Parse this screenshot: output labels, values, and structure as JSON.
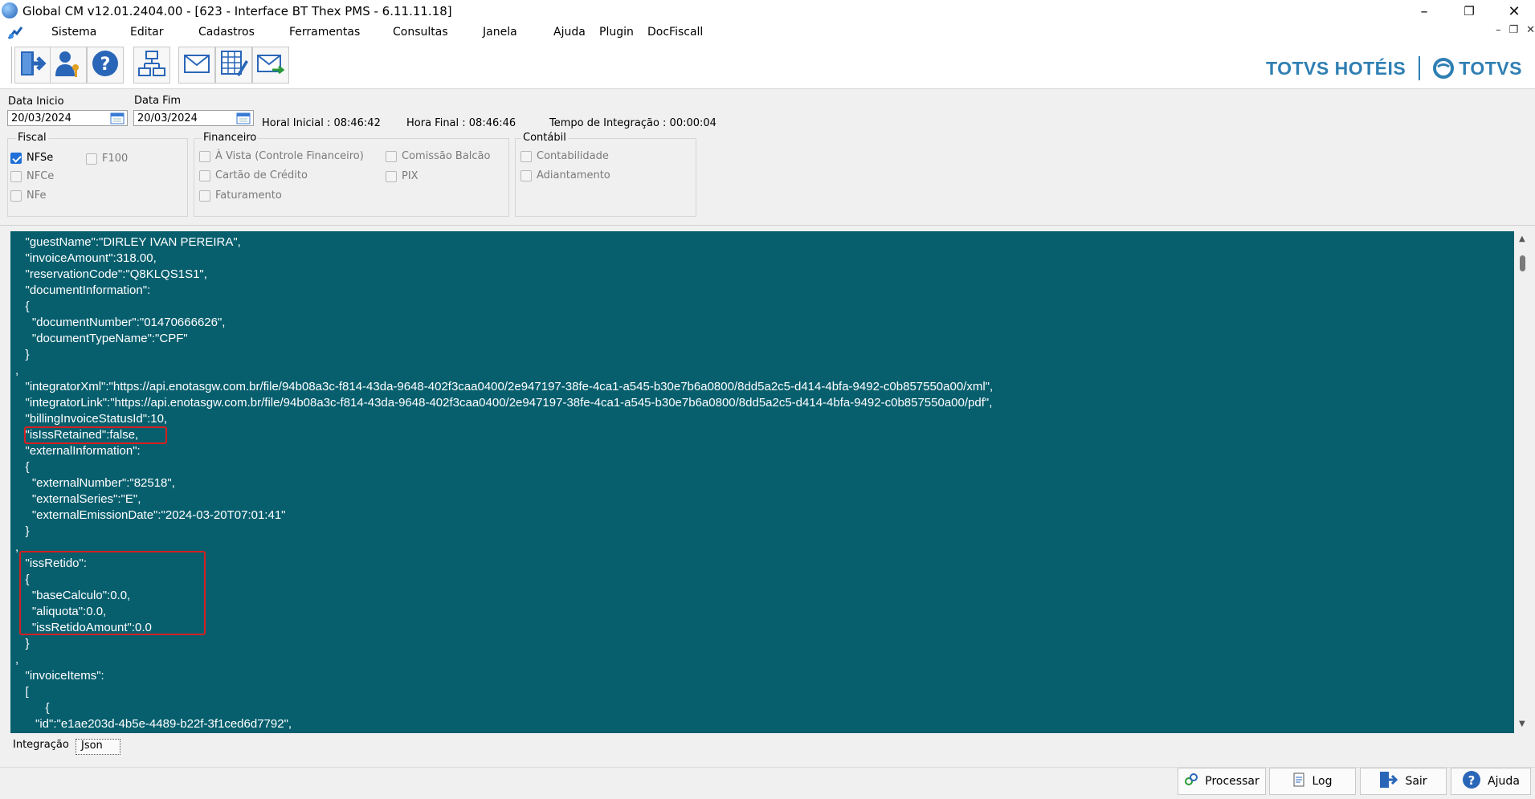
{
  "window": {
    "title": "Global CM v12.01.2404.00 - [623 - Interface BT Thex PMS - 6.11.11.18]"
  },
  "menu": {
    "items": [
      "Sistema",
      "Editar",
      "Cadastros",
      "Ferramentas",
      "Consultas",
      "Janela",
      "Ajuda",
      "Plugin",
      "DocFiscall"
    ]
  },
  "toolbar": {
    "icons": [
      "exit-icon",
      "user-key-icon",
      "help-icon",
      "network-icon",
      "mail-icon",
      "table-edit-icon",
      "mail-send-icon"
    ]
  },
  "brand": {
    "name": "TOTVS HOTÉIS",
    "logo_text": "TOTVS",
    "color": "#2f7fb3"
  },
  "filters": {
    "data_inicio_label": "Data Inicio",
    "data_inicio_value": "20/03/2024",
    "data_fim_label": "Data Fim",
    "data_fim_value": "20/03/2024",
    "hora_inicial": "Horal Inicial : 08:46:42",
    "hora_final": "Hora Final : 08:46:46",
    "tempo_integracao": "Tempo de Integração :  00:00:04"
  },
  "groups": {
    "fiscal": {
      "title": "Fiscal",
      "options": [
        {
          "label": "NFSe",
          "checked": true
        },
        {
          "label": "F100",
          "checked": false
        },
        {
          "label": "NFCe",
          "checked": false
        },
        {
          "label": "NFe",
          "checked": false
        }
      ]
    },
    "financeiro": {
      "title": "Financeiro",
      "options": [
        {
          "label": "À Vista (Controle Financeiro)",
          "checked": false
        },
        {
          "label": "Comissão Balcão",
          "checked": false
        },
        {
          "label": "Cartão de Crédito",
          "checked": false
        },
        {
          "label": "PIX",
          "checked": false
        },
        {
          "label": "Faturamento",
          "checked": false
        }
      ]
    },
    "contabil": {
      "title": "Contábil",
      "options": [
        {
          "label": "Contabilidade",
          "checked": false
        },
        {
          "label": "Adiantamento",
          "checked": false
        }
      ]
    }
  },
  "json_view": {
    "background": "#075f6e",
    "highlight_color": "#d42020",
    "lines": [
      "   \"guestName\":\"DIRLEY IVAN PEREIRA\",",
      "   \"invoiceAmount\":318.00,",
      "   \"reservationCode\":\"Q8KLQS1S1\",",
      "   \"documentInformation\":",
      "   {",
      "     \"documentNumber\":\"01470666626\",",
      "     \"documentTypeName\":\"CPF\"",
      "   }",
      ",",
      "   \"integratorXml\":\"https://api.enotasgw.com.br/file/94b08a3c-f814-43da-9648-402f3caa0400/2e947197-38fe-4ca1-a545-b30e7b6a0800/8dd5a2c5-d414-4bfa-9492-c0b857550a00/xml\",",
      "   \"integratorLink\":\"https://api.enotasgw.com.br/file/94b08a3c-f814-43da-9648-402f3caa0400/2e947197-38fe-4ca1-a545-b30e7b6a0800/8dd5a2c5-d414-4bfa-9492-c0b857550a00/pdf\",",
      "   \"billingInvoiceStatusId\":10,",
      "   \"isIssRetained\":false,",
      "   \"externalInformation\":",
      "   {",
      "     \"externalNumber\":\"82518\",",
      "     \"externalSeries\":\"E\",",
      "     \"externalEmissionDate\":\"2024-03-20T07:01:41\"",
      "   }",
      ",",
      "   \"issRetido\":",
      "   {",
      "     \"baseCalculo\":0.0,",
      "     \"aliquota\":0.0,",
      "     \"issRetidoAmount\":0.0",
      "   }",
      ",",
      "   \"invoiceItems\":",
      "   [",
      "         {",
      "      \"id\":\"e1ae203d-4b5e-4489-b22f-3f1ced6d7792\","
    ]
  },
  "tabs": {
    "integracao": "Integração",
    "json": "Json"
  },
  "buttons": {
    "processar": "Processar",
    "log": "Log",
    "sair": "Sair",
    "ajuda": "Ajuda"
  }
}
